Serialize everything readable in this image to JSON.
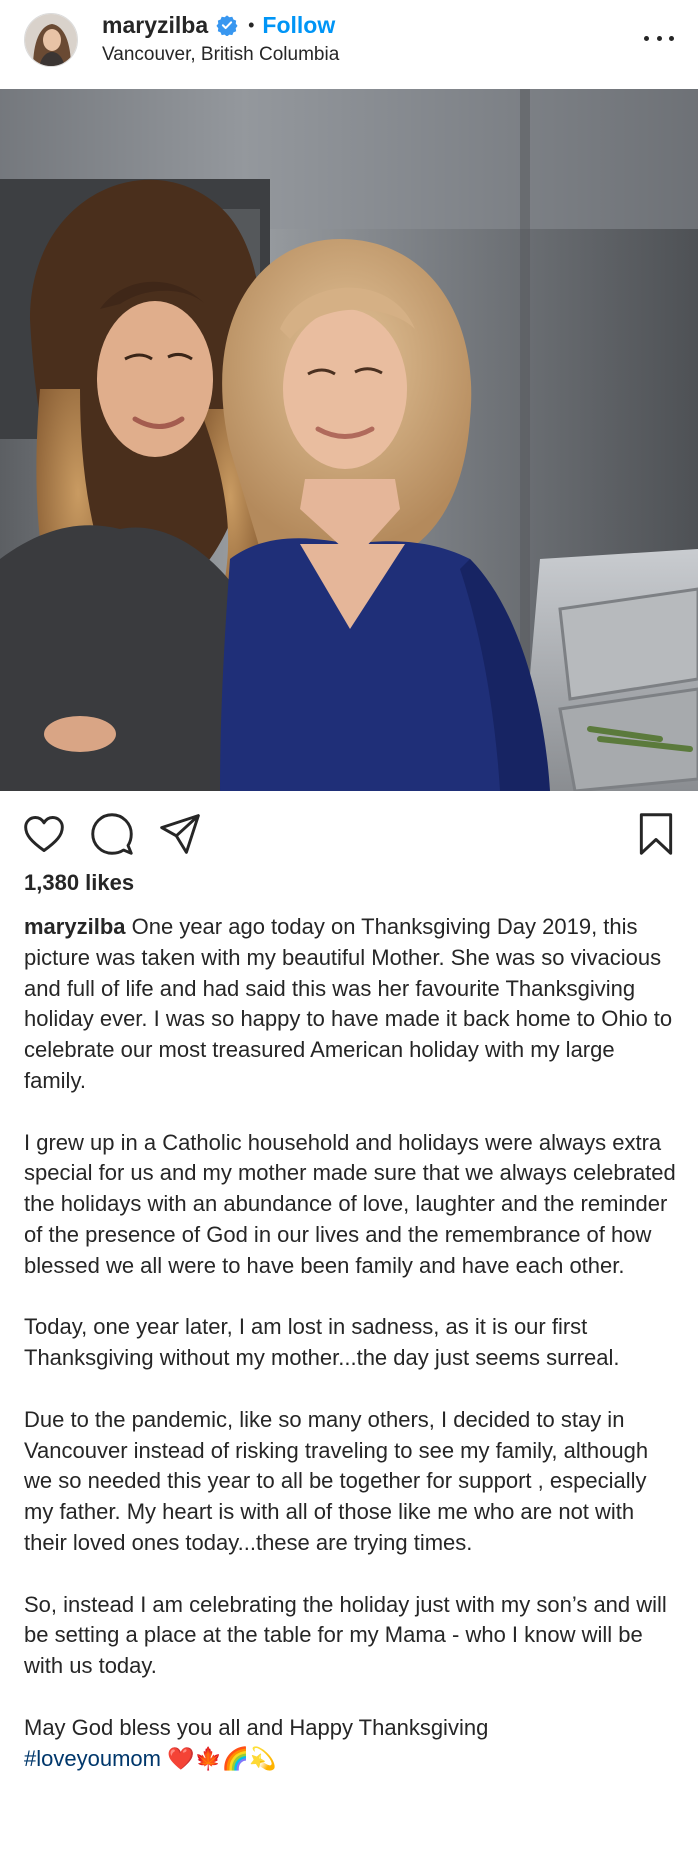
{
  "post": {
    "username": "maryzilba",
    "separator": "•",
    "follow_label": "Follow",
    "location": "Vancouver, British Columbia",
    "likes": "1,380 likes"
  },
  "icons": {
    "avatar": "avatar",
    "verified": "verified-badge-icon",
    "more": "more-options-icon",
    "like": "heart-icon",
    "comment": "comment-icon",
    "share": "share-icon",
    "save": "bookmark-icon"
  },
  "colors": {
    "accent": "#0095f6",
    "text": "#262626",
    "hashtag": "#00376b"
  },
  "caption": {
    "paragraph_1": "One year ago today on Thanksgiving Day 2019, this picture was taken with my beautiful Mother. She was so vivacious and full of life and had said this was her favourite Thanksgiving holiday ever. I was so happy to have made it back home to Ohio to celebrate our most treasured American holiday with my large family.",
    "paragraph_2": "I grew up in a Catholic household and holidays were always extra special for us and my mother made sure that we always celebrated the holidays with an abundance of love, laughter and the reminder of the presence of God in our lives and the remembrance of how blessed we all were to have been family and have each other.",
    "paragraph_3": "Today, one year later, I am lost in sadness, as it is our first Thanksgiving without my mother...the day just seems surreal.",
    "paragraph_4": "Due to the pandemic, like so many others, I decided to stay in Vancouver instead of risking traveling to see my family, although we so needed this year to all be together for support , especially my father. My heart is with all of those like me who are not with their loved ones today...these are trying times.",
    "paragraph_5": "So, instead I am celebrating the holiday just with my son’s and will be setting a place at the table for my Mama - who I know will be with us today.",
    "paragraph_6": "May God bless you all and Happy Thanksgiving",
    "hashtag": "#loveyoumom",
    "emojis": "❤️🍁🌈💫"
  }
}
